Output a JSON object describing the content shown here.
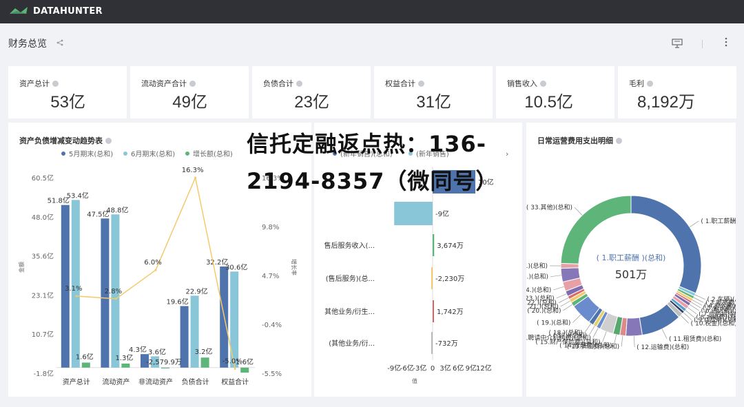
{
  "app": {
    "brand": "DATAHUNTER"
  },
  "page": {
    "title": "财务总览"
  },
  "kpis": [
    {
      "label": "资产总计",
      "value": "53亿"
    },
    {
      "label": "流动资产合计",
      "value": "49亿"
    },
    {
      "label": "负债合计",
      "value": "23亿"
    },
    {
      "label": "权益合计",
      "value": "31亿"
    },
    {
      "label": "销售收入",
      "value": "10.5亿"
    },
    {
      "label": "毛利",
      "value": "8,192万"
    }
  ],
  "panels": {
    "left_title": "资产负债增减变动趋势表",
    "right_title": "日常运营费用支出明细"
  },
  "overlay_text": "信托定融返点热：136-2194-8357（微同号）",
  "colors": {
    "blue": "#4e73ad",
    "cyan": "#89c6d8",
    "green": "#5db57a",
    "yellow": "#f5c96b",
    "topbar": "#2f3137"
  },
  "chart_data": [
    {
      "type": "bar",
      "title": "资产负债增减变动趋势表",
      "legend": [
        "5月期末(总和)",
        "6月期末(总和)",
        "增长额(总和)"
      ],
      "categories": [
        "资产总计",
        "流动资产",
        "非流动资产",
        "负债合计",
        "权益合计"
      ],
      "series": [
        {
          "name": "5月期末(总和)",
          "values": [
            51.8,
            47.5,
            4.3,
            19.6,
            32.2
          ],
          "labels": [
            "51.8亿",
            "47.5亿",
            "4.3亿",
            "19.6亿",
            "32.2亿"
          ]
        },
        {
          "name": "6月期末(总和)",
          "values": [
            53.4,
            48.8,
            3.6,
            22.9,
            30.6
          ],
          "labels": [
            "53.4亿",
            "48.8亿",
            "3.6亿",
            "22.9亿",
            "30.6亿"
          ]
        },
        {
          "name": "增长额(总和)",
          "values": [
            1.6,
            1.3,
            -0.258,
            3.2,
            -1.6
          ],
          "labels": [
            "1.6亿",
            "1.3亿",
            "-2,579.9万",
            "3.2亿",
            "-1.6亿"
          ]
        },
        {
          "name": "增长率",
          "axis": "right",
          "values": [
            3.1,
            2.8,
            6.0,
            16.3,
            -5.0
          ],
          "labels": [
            "3.1%",
            "2.8%",
            "6.0%",
            "16.3%",
            "-5.0%"
          ]
        }
      ],
      "ylim": [
        -1.8,
        60.5
      ],
      "yticks": [
        "60.5亿",
        "48.0亿",
        "35.6亿",
        "23.1亿",
        "10.7亿",
        "-1.8亿"
      ],
      "y2lim": [
        -5.5,
        16.3
      ],
      "y2ticks": [
        "16.3%",
        "9.8%",
        "4.7%",
        "-0.4%",
        "-5.5%"
      ],
      "ylabel": "金额",
      "y2label": "增长率"
    },
    {
      "type": "bar",
      "orientation": "horizontal",
      "legend": [
        "(新年销售)(总和)",
        "(新年销售)"
      ],
      "categories": [
        "",
        "",
        "售后服务收入(...",
        "(售后服务)(总...",
        "其他业务/衍生...",
        "(其他业务/衍..."
      ],
      "values": [
        1.0,
        -0.9,
        0.03674,
        -0.0223,
        0.01742,
        -0.00732
      ],
      "labels": [
        "10亿",
        "-9亿",
        "3,674万",
        "-2,230万",
        "1,742万",
        "-732万"
      ],
      "xticks": [
        "-9亿",
        "-6亿",
        "-3亿",
        "0",
        "3亿",
        "6亿",
        "9亿",
        "12亿"
      ],
      "xlabel": "值"
    },
    {
      "type": "pie",
      "title": "日常运营费用支出明细",
      "center_label": "( 1.职工薪酬 )(总和)",
      "center_value": "501万",
      "slices": [
        {
          "label": "1.职工薪酬",
          "value": 501
        },
        {
          "label": "2.车辆",
          "value": 12
        },
        {
          "label": "3.差旅费",
          "value": 10
        },
        {
          "label": "4.办公费",
          "value": 10
        },
        {
          "label": "5.会议费",
          "value": 8
        },
        {
          "label": "6.通讯费",
          "value": 12
        },
        {
          "label": "7.业务招待费",
          "value": 14
        },
        {
          "label": "8.水电费",
          "value": 12
        },
        {
          "label": "9.IT费用",
          "value": 10
        },
        {
          "label": "10.税金",
          "value": 18
        },
        {
          "label": "11.租赁费",
          "value": 150
        },
        {
          "label": "12.运输费",
          "value": 60
        },
        {
          "label": "13.折旧费",
          "value": 22
        },
        {
          "label": "14.修理费",
          "value": 25
        },
        {
          "label": "15.财产保险费",
          "value": 50
        },
        {
          "label": "16.聘请中介机构费",
          "value": 15
        },
        {
          "label": "17.",
          "value": 14
        },
        {
          "label": "18.",
          "value": 18
        },
        {
          "label": "19.",
          "value": 80
        },
        {
          "label": "20.",
          "value": 16
        },
        {
          "label": "21.",
          "value": 14
        },
        {
          "label": "22.",
          "value": 12
        },
        {
          "label": "23.",
          "value": 20
        },
        {
          "label": "24.",
          "value": 35
        },
        {
          "label": "25.",
          "value": 50
        },
        {
          "label": "26.",
          "value": 18
        },
        {
          "label": "33.其他",
          "value": 390
        }
      ]
    }
  ]
}
